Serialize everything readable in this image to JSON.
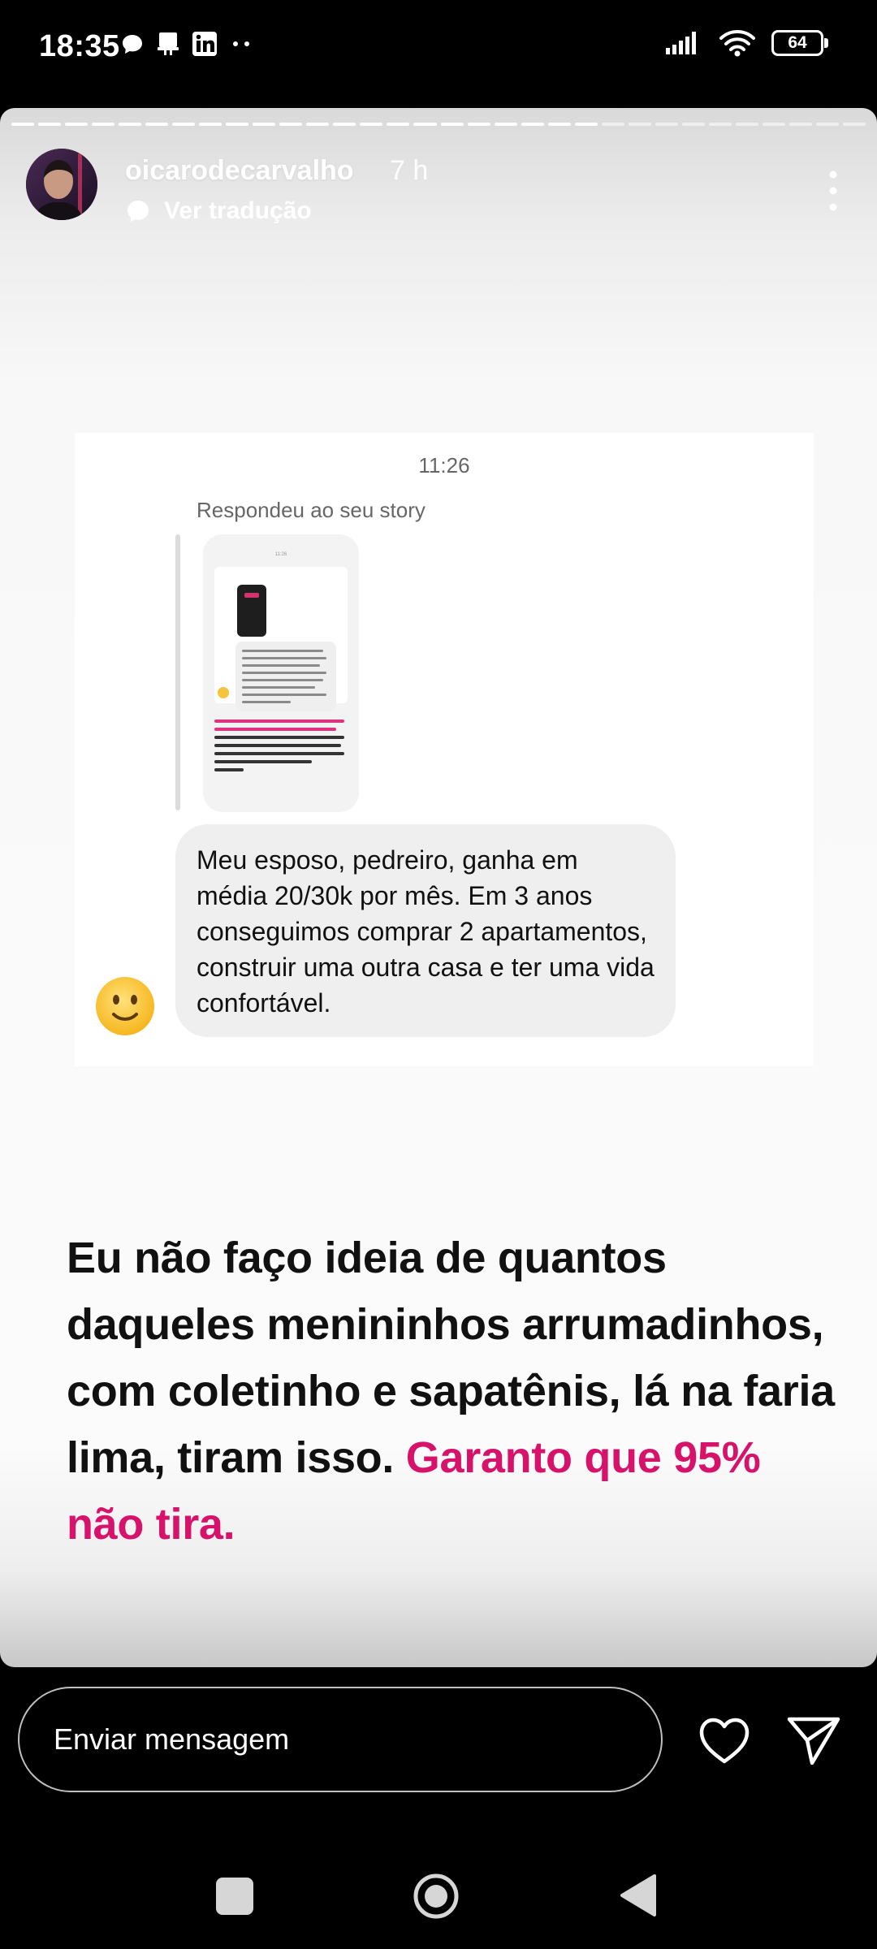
{
  "status_bar": {
    "time": "18:35",
    "battery": "64",
    "left_icons": [
      "chat-bubble-icon",
      "notification-icon",
      "linkedin-icon",
      "more-dots-icon"
    ],
    "right_icons": [
      "signal-icon",
      "wifi-icon",
      "battery-icon"
    ]
  },
  "story": {
    "progress_segments_total": 32,
    "progress_segments_done": 22,
    "username": "oicarodecarvalho",
    "time_ago": "7 h",
    "translate_label": "Ver tradução"
  },
  "dm": {
    "time": "11:26",
    "reply_label": "Respondeu ao seu story",
    "message": "Meu esposo, pedreiro, ganha em média 20/30k por mês. Em 3 anos conseguimos comprar 2 apartamentos, construir uma outra casa e ter uma vida confortável.",
    "emoji": "slightly-smiling-face-icon"
  },
  "headline": {
    "text": "Eu não faço ideia de quantos daqueles menininhos arrumadinhos, com coletinho e sapatênis, lá na faria lima, tiram isso.",
    "highlight": "Garanto que 95% não tira.",
    "highlight_color": "#d6126b"
  },
  "message_bar": {
    "placeholder": "Enviar mensagem"
  }
}
